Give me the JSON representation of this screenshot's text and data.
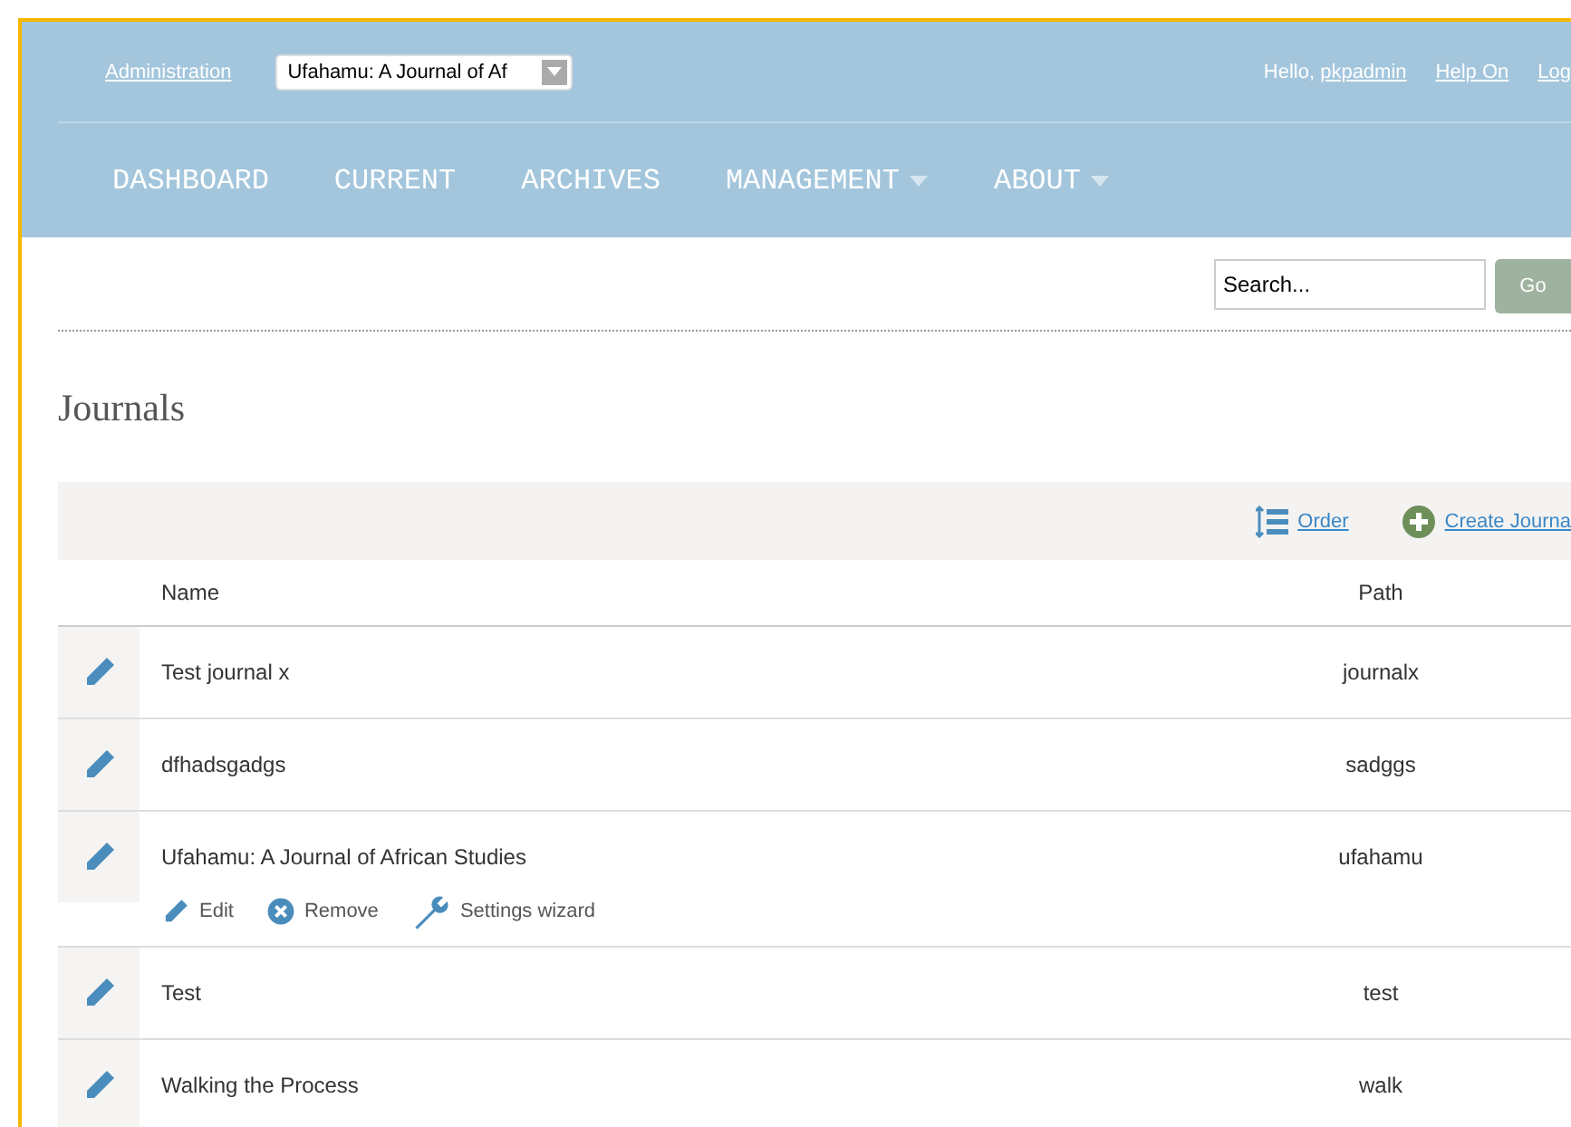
{
  "top_bar": {
    "admin_link": "Administration",
    "journal_select": {
      "value": "Ufahamu: A Journal of Af"
    },
    "greeting": "Hello,",
    "user_link": "pkpadmin",
    "links": [
      "Help On",
      "Log"
    ]
  },
  "nav": [
    {
      "label": "DASHBOARD",
      "has_menu": false
    },
    {
      "label": "CURRENT",
      "has_menu": false
    },
    {
      "label": "ARCHIVES",
      "has_menu": false
    },
    {
      "label": "MANAGEMENT",
      "has_menu": true
    },
    {
      "label": "ABOUT",
      "has_menu": true
    }
  ],
  "search": {
    "placeholder": "Search...",
    "button": "Go"
  },
  "page_title": "Journals",
  "toolbar": {
    "order": "Order",
    "create": "Create Journa"
  },
  "table": {
    "columns": [
      "Name",
      "Path"
    ],
    "rows": [
      {
        "name": "Test journal x",
        "path": "journalx",
        "expanded": false
      },
      {
        "name": "dfhadsgadgs",
        "path": "sadggs",
        "expanded": false
      },
      {
        "name": "Ufahamu: A Journal of African Studies",
        "path": "ufahamu",
        "expanded": true,
        "actions": [
          {
            "kind": "edit",
            "label": "Edit"
          },
          {
            "kind": "remove",
            "label": "Remove"
          },
          {
            "kind": "wizard",
            "label": "Settings wizard"
          }
        ]
      },
      {
        "name": "Test",
        "path": "test",
        "expanded": false
      },
      {
        "name": "Walking the Process",
        "path": "walk",
        "expanded": false
      }
    ]
  }
}
